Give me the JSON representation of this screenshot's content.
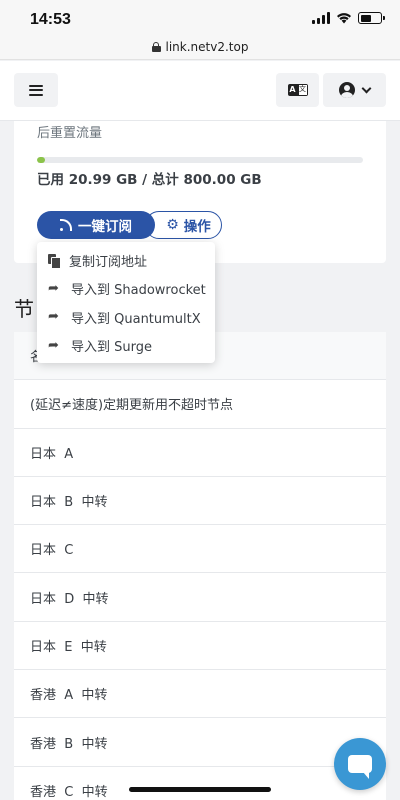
{
  "status_bar": {
    "time": "14:53"
  },
  "browser": {
    "url": "link.netv2.top"
  },
  "header": {},
  "subscription": {
    "reset_text": "后重置流量",
    "usage_text": "已用 20.99 GB / 总计 800.00 GB",
    "usage_fraction": 0.026,
    "subscribe_label": "一键订阅",
    "actions_label": "操作"
  },
  "dropdown": {
    "items": [
      {
        "label": "复制订阅地址",
        "icon": "copy-icon"
      },
      {
        "label": "导入到 Shadowrocket",
        "icon": "share-icon"
      },
      {
        "label": "导入到 QuantumultX",
        "icon": "share-icon"
      },
      {
        "label": "导入到 Surge",
        "icon": "share-icon"
      }
    ]
  },
  "nodes": {
    "section_title_visible": "节",
    "header_visible": "名",
    "rows": [
      "(延迟≠速度)定期更新用不超时节点",
      "日本  A",
      "日本  B  中转",
      "日本  C",
      "日本  D  中转",
      "日本  E  中转",
      "香港  A  中转",
      "香港  B  中转",
      "香港  C  中转"
    ]
  },
  "colors": {
    "primary": "#2b54a6",
    "progress": "#8bc34a",
    "chat": "#3a97d4"
  }
}
